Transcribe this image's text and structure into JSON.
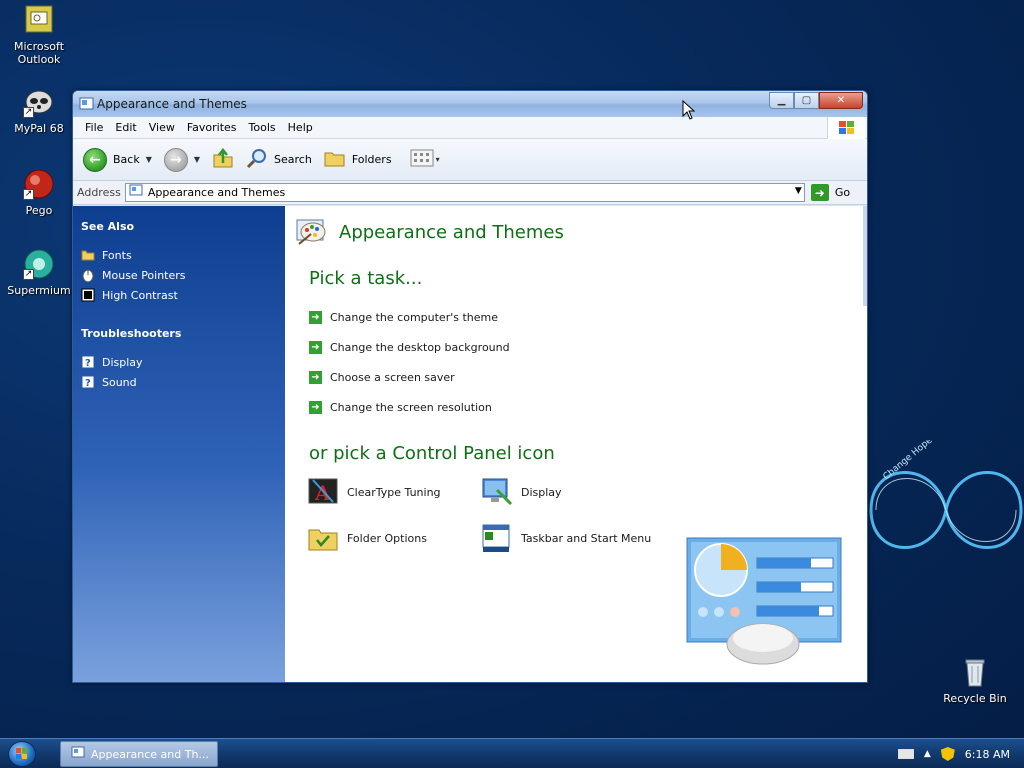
{
  "desktop": {
    "icons": [
      {
        "label": "Microsoft Outlook"
      },
      {
        "label": "MyPal 68"
      },
      {
        "label": "Pego"
      },
      {
        "label": "Supermium"
      },
      {
        "label": "Recycle Bin"
      }
    ],
    "wallpaper_text": "Change Hope"
  },
  "window": {
    "title": "Appearance and Themes",
    "menu": [
      "File",
      "Edit",
      "View",
      "Favorites",
      "Tools",
      "Help"
    ],
    "toolbar": {
      "back_label": "Back",
      "search_label": "Search",
      "folders_label": "Folders"
    },
    "address": {
      "label": "Address",
      "value": "Appearance and Themes",
      "go_label": "Go"
    },
    "see_also": {
      "heading": "See Also",
      "items": [
        {
          "label": "Fonts",
          "icon": "folder-icon"
        },
        {
          "label": "Mouse Pointers",
          "icon": "mouse-icon"
        },
        {
          "label": "High Contrast",
          "icon": "contrast-icon"
        }
      ]
    },
    "troubleshooters": {
      "heading": "Troubleshooters",
      "items": [
        {
          "label": "Display",
          "icon": "help-icon"
        },
        {
          "label": "Sound",
          "icon": "help-icon"
        }
      ]
    },
    "main": {
      "title": "Appearance and Themes",
      "pick_task": "Pick a task...",
      "tasks": [
        "Change the computer's theme",
        "Change the desktop background",
        "Choose a screen saver",
        "Change the screen resolution"
      ],
      "or_pick": "or pick a Control Panel icon",
      "cp_icons": [
        {
          "label": "ClearType Tuning",
          "icon": "cleartype-icon"
        },
        {
          "label": "Display",
          "icon": "display-icon"
        },
        {
          "label": "Folder Options",
          "icon": "folder-options-icon"
        },
        {
          "label": "Taskbar and Start Menu",
          "icon": "taskbar-icon"
        }
      ]
    }
  },
  "taskbar": {
    "task_label": "Appearance and Th...",
    "clock": "6:18 AM"
  },
  "colors": {
    "heading_green": "#0e6f16",
    "taskpane_blue": "#0e3e8f"
  }
}
